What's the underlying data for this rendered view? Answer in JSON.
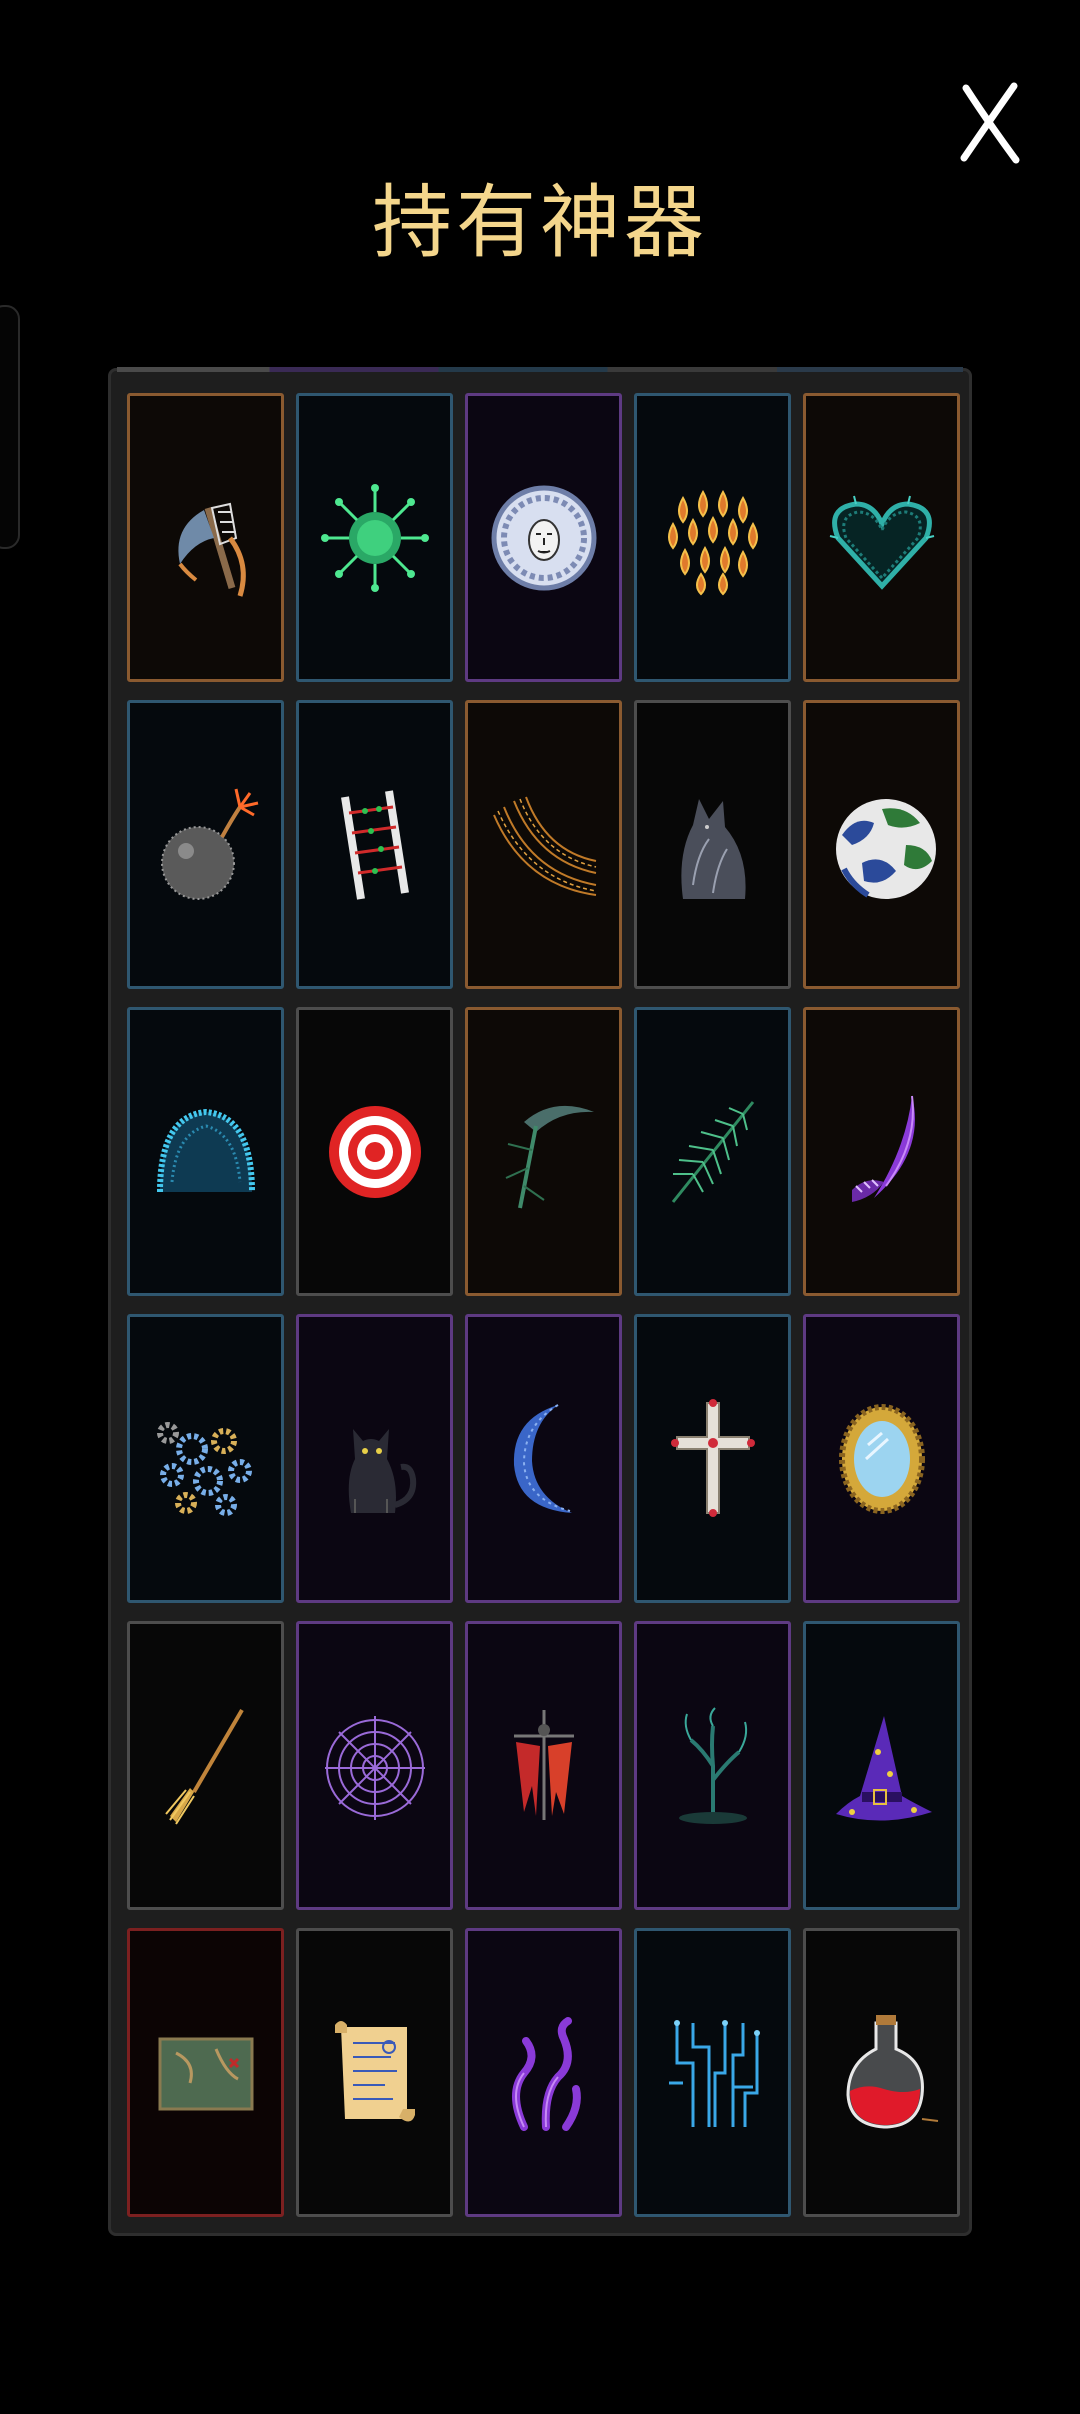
{
  "header": {
    "title": "持有神器",
    "close_icon": "close-x-icon"
  },
  "artifacts": [
    {
      "name": "axe-icon",
      "frame": "orange"
    },
    {
      "name": "virus-icon",
      "frame": "blue"
    },
    {
      "name": "medusa-coin-icon",
      "frame": "purple"
    },
    {
      "name": "dragon-scales-icon",
      "frame": "blue"
    },
    {
      "name": "thorn-heart-icon",
      "frame": "orange"
    },
    {
      "name": "bomb-icon",
      "frame": "blue"
    },
    {
      "name": "dna-ladder-icon",
      "frame": "blue"
    },
    {
      "name": "fiber-arc-icon",
      "frame": "orange"
    },
    {
      "name": "shadow-beast-icon",
      "frame": "gray"
    },
    {
      "name": "earth-globe-icon",
      "frame": "orange"
    },
    {
      "name": "blue-dome-icon",
      "frame": "blue"
    },
    {
      "name": "target-icon",
      "frame": "gray"
    },
    {
      "name": "scythe-icon",
      "frame": "orange"
    },
    {
      "name": "green-fern-icon",
      "frame": "blue"
    },
    {
      "name": "purple-claw-icon",
      "frame": "orange"
    },
    {
      "name": "gears-icon",
      "frame": "blue"
    },
    {
      "name": "black-cat-icon",
      "frame": "purple"
    },
    {
      "name": "crescent-moon-icon",
      "frame": "purple"
    },
    {
      "name": "holy-cross-icon",
      "frame": "blue"
    },
    {
      "name": "gold-mirror-icon",
      "frame": "purple"
    },
    {
      "name": "broom-icon",
      "frame": "gray"
    },
    {
      "name": "spider-web-icon",
      "frame": "purple"
    },
    {
      "name": "scarecrow-icon",
      "frame": "purple"
    },
    {
      "name": "dead-tree-icon",
      "frame": "purple"
    },
    {
      "name": "witch-hat-icon",
      "frame": "blue"
    },
    {
      "name": "treasure-map-icon",
      "frame": "red"
    },
    {
      "name": "scroll-icon",
      "frame": "gray"
    },
    {
      "name": "tentacles-icon",
      "frame": "purple"
    },
    {
      "name": "circuit-icon",
      "frame": "blue"
    },
    {
      "name": "potion-flask-icon",
      "frame": "gray"
    }
  ],
  "colors": {
    "title": "#f4d68c",
    "background": "#000000"
  }
}
